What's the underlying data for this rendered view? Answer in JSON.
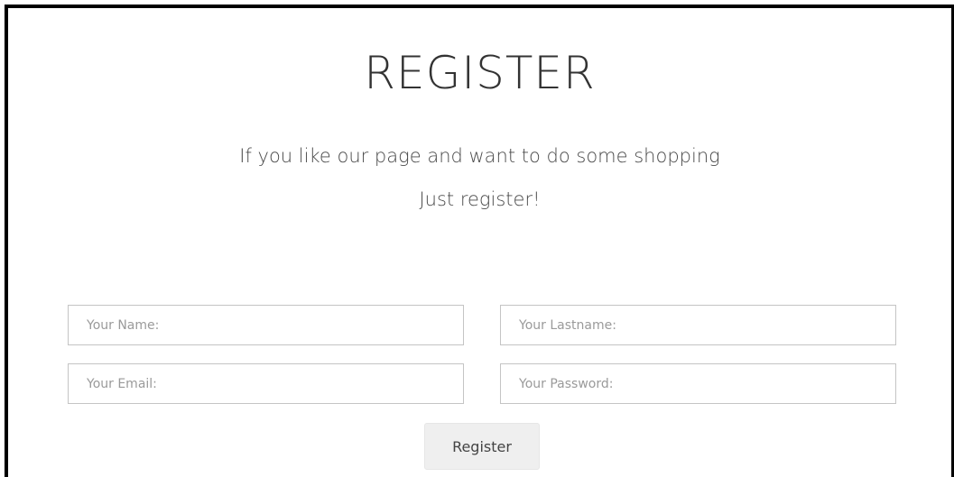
{
  "page": {
    "title": "REGISTER",
    "subtitle_line1": "If you like our page and want to do some shopping",
    "subtitle_line2": "Just register!"
  },
  "form": {
    "name": {
      "placeholder": "Your Name:",
      "value": ""
    },
    "lastname": {
      "placeholder": "Your Lastname:",
      "value": ""
    },
    "email": {
      "placeholder": "Your Email:",
      "value": ""
    },
    "password": {
      "placeholder": "Your Password:",
      "value": ""
    },
    "submit_label": "Register"
  },
  "colors": {
    "frame_border": "#000000",
    "field_border": "#c4c4c4",
    "button_background": "#efefef",
    "text": "#444444"
  }
}
